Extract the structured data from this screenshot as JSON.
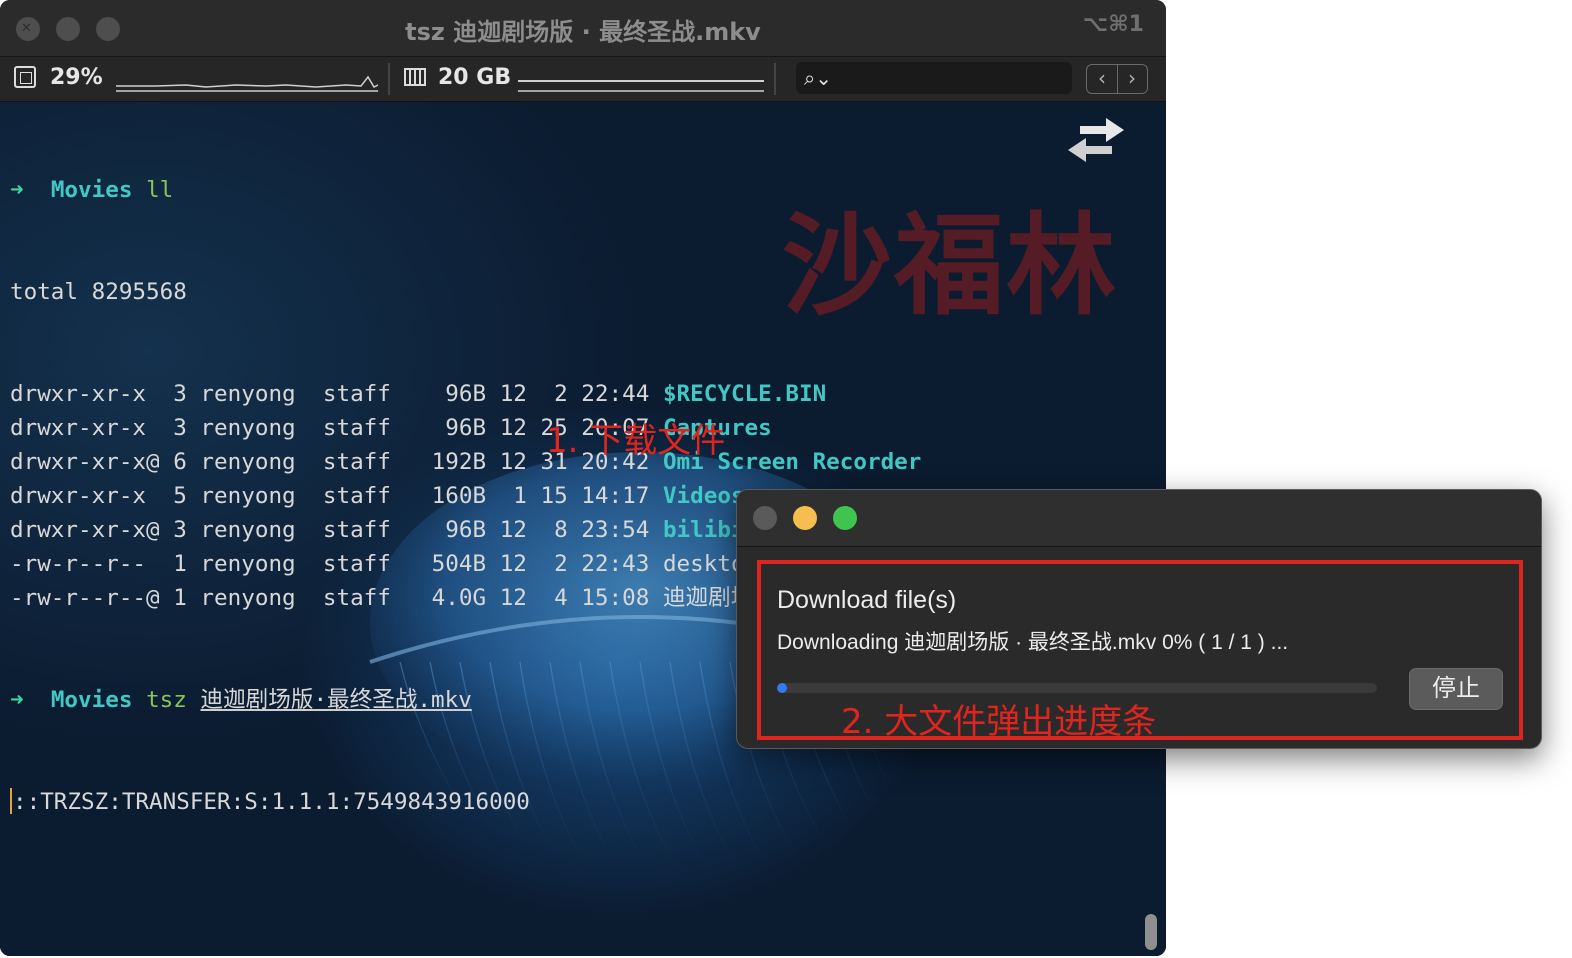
{
  "window": {
    "title": "tsz 迪迦剧场版 · 最终圣战.mkv",
    "shortcut": "⌥⌘1"
  },
  "statusbar": {
    "cpu": "29%",
    "memory": "20 GB",
    "search_icon": "search-icon"
  },
  "terminal": {
    "prompt_arrow": "➜",
    "prompt_dir": "Movies",
    "cmd1": "ll",
    "total": "total 8295568",
    "entries": [
      {
        "perm": "drwxr-xr-x ",
        "links": "3",
        "owner": "renyong",
        "group": "staff",
        "size": "96B",
        "month": "12",
        "day": "2",
        "time": "22:44",
        "name": "$RECYCLE.BIN",
        "is_dir": true
      },
      {
        "perm": "drwxr-xr-x ",
        "links": "3",
        "owner": "renyong",
        "group": "staff",
        "size": "96B",
        "month": "12",
        "day": "25",
        "time": "20:07",
        "name": "Captures",
        "is_dir": true
      },
      {
        "perm": "drwxr-xr-x@",
        "links": "6",
        "owner": "renyong",
        "group": "staff",
        "size": "192B",
        "month": "12",
        "day": "31",
        "time": "20:42",
        "name": "Omi Screen Recorder",
        "is_dir": true
      },
      {
        "perm": "drwxr-xr-x ",
        "links": "5",
        "owner": "renyong",
        "group": "staff",
        "size": "160B",
        "month": "1",
        "day": "15",
        "time": "14:17",
        "name": "Videos",
        "is_dir": true
      },
      {
        "perm": "drwxr-xr-x@",
        "links": "3",
        "owner": "renyong",
        "group": "staff",
        "size": "96B",
        "month": "12",
        "day": "8",
        "time": "23:54",
        "name": "bilibili",
        "is_dir": true
      },
      {
        "perm": "-rw-r--r-- ",
        "links": "1",
        "owner": "renyong",
        "group": "staff",
        "size": "504B",
        "month": "12",
        "day": "2",
        "time": "22:43",
        "name": "desktop.ini",
        "is_dir": false
      },
      {
        "perm": "-rw-r--r--@",
        "links": "1",
        "owner": "renyong",
        "group": "staff",
        "size": "4.0G",
        "month": "12",
        "day": "4",
        "time": "15:08",
        "name": "迪迦剧场版·最终圣战.mkv",
        "is_dir": false
      }
    ],
    "cmd2": "tsz",
    "cmd2_arg": "迪迦剧场版·最终圣战.mkv",
    "transfer_line": "::TRZSZ:TRANSFER:S:1.1.1:7549843916000",
    "annotation1": "1. 下载文件",
    "watermark": "沙福林"
  },
  "dialog": {
    "heading": "Download file(s)",
    "status": "Downloading 迪迦剧场版 · 最终圣战.mkv 0% ( 1 / 1 ) ...",
    "progress_fraction": 0.0,
    "stop_label": "停止",
    "annotation2": "2. 大文件弹出进度条",
    "colors": {
      "annotation": "#e0241e",
      "progress": "#2f7cf6"
    }
  }
}
